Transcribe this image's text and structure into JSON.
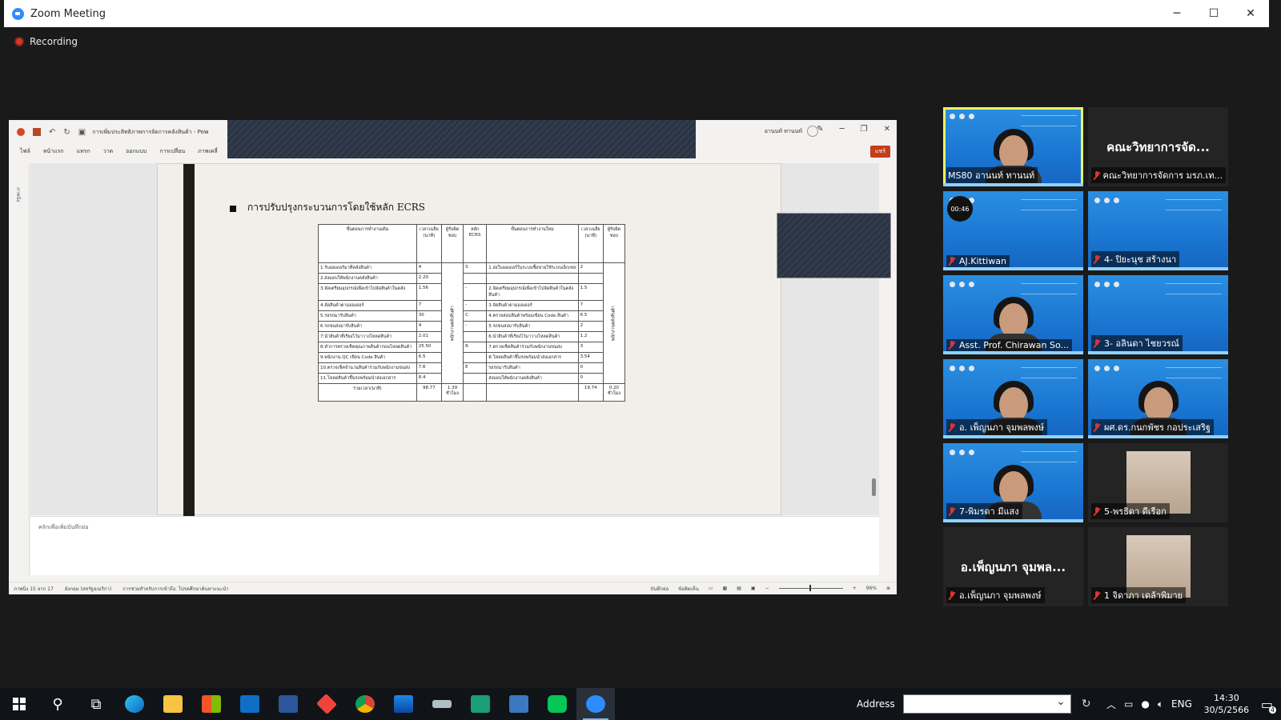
{
  "window": {
    "title": "Zoom Meeting"
  },
  "recording": {
    "label": "Recording"
  },
  "ppt": {
    "doc_name": "การเพิ่มประสิทธิภาพการจัดการคลังสินค้า - Pow",
    "user_name": "อานนท์ ทานนท์",
    "share_label": "แชร์",
    "ribbon_tabs": [
      "ไฟล์",
      "หน้าแรก",
      "แทรก",
      "วาด",
      "ออกแบบ",
      "การเปลี่ยน",
      "ภาพเคลื่"
    ],
    "thumb_pane_label": "ภาพนิ่ง",
    "notes_placeholder": "คลิกเพื่อเพิ่มบันทึกย่อ",
    "status_left": [
      "ภาพนิ่ง 15 จาก 17",
      "อังกฤษ (สหรัฐอเมริกา)",
      "การช่วยสำหรับการเข้าถึง: โปรดศึกษาค้นหาแนะนำ"
    ],
    "status_right": [
      "บันทึกย่อ",
      "ข้อคิดเห็น",
      "96%"
    ],
    "slide": {
      "title": "การปรับปรุงกระบวนการโดยใช้หลัก ECRS",
      "headers": [
        "ขั้นตอนการทำงานเดิม",
        "เวลาเฉลี่ย (นาที)",
        "ผู้รับผิดชอบ",
        "หลัก ECRS",
        "ขั้นตอนการทำงานใหม่",
        "เวลาเฉลี่ย (นาที)",
        "ผู้รับผิดชอบ"
      ],
      "rows": [
        [
          "1.รับออเดอร์มาที่คลังสินค้า",
          "4",
          "S",
          "1.ส่งใบออเดอร์ในระบบซื้อขายใช้ระบบเอ็กเซล",
          "2"
        ],
        [
          "2.ส่งมอบให้พนักงานคลังสินค้า",
          "2.20",
          "",
          "",
          ""
        ],
        [
          "3.จัดเตรียมอุปกรณ์เพื่อเข้าไปจัดสินค้าในคลัง",
          "1.56",
          "-",
          "2.จัดเตรียมอุปกรณ์เพื่อเข้าไปจัดสินค้าในคลังสินค้า",
          "1.5"
        ],
        [
          "4.จัดสินค้าตามออเดอร์",
          "7",
          "-",
          "3.จัดสินค้าตามออเดอร์",
          "7"
        ],
        [
          "5.รอรถมารับสินค้า",
          "30",
          "C",
          "4.ตรวจสอบสินค้าพร้อมเขียน Code สินค้า",
          "6.5"
        ],
        [
          "6.รถขนส่งมารับสินค้า",
          "4",
          "-",
          "5.รถขนส่งมารับสินค้า",
          "2"
        ],
        [
          "7.นำสินค้าที่เรียงไว้มาวางโหลดสินค้า",
          "2.01",
          "",
          "6.นำสินค้าที่เรียงไว้มาวางโหลดสินค้า",
          "1.2"
        ],
        [
          "8.ทำการตรวจเช็คคุณภาพสินค้าก่อนโหลดสินค้า",
          "25.50",
          "R",
          "7.ตรวจเช็คสินค้าร่วมกับพนักงานขนส่ง",
          "3"
        ],
        [
          "9.พนักงาน QC เขียน Code สินค้า",
          "6.5",
          "",
          "8.โหลดสินค้าขึ้นรถพร้อมนำส่งเอกสาร",
          "3.54"
        ],
        [
          "10.ตรวจเช็คจำนวนสินค้าร่วมกับพนักงานขนส่ง",
          "7.6",
          "E",
          "รอรถมารับสินค้า",
          "0"
        ],
        [
          "11.โหลดสินค้าขึ้นรถพร้อมนำส่งเอกสาร",
          "8.4",
          "",
          "ส่งมอบให้พนักงานคลังสินค้า",
          "0"
        ]
      ],
      "staff_label": "พนักงานคลังสินค้า",
      "total_label": "รวมเวลา(นาที)",
      "total_old": "98.77",
      "total_old_hours": "1.39 ชั่วโมง",
      "total_new": "19.74",
      "total_new_hours": "0.20 ชั่วโมง"
    }
  },
  "participants": [
    {
      "name": "MS80 อานนท์ ทานนท์",
      "type": "video",
      "active": true,
      "mic_off": false
    },
    {
      "name": "คณะวิทยาการจัดการ มรภ.เท...",
      "big_name": "คณะวิทยาการจัด...",
      "type": "name",
      "mic_off": true
    },
    {
      "name": "AJ.Kittiwan",
      "type": "video-empty",
      "timer": "00:46",
      "mic_off": true
    },
    {
      "name": "4- ปิยะนุช สร้างนา",
      "type": "video-empty",
      "mic_off": true
    },
    {
      "name": "Asst. Prof. Chirawan So...",
      "type": "video",
      "mic_off": true
    },
    {
      "name": "3- อลินดา ไชยวรณ์",
      "type": "video-empty",
      "mic_off": true
    },
    {
      "name": "อ. เพ็ญนภา จุมพลพงษ์",
      "type": "video",
      "mic_off": true
    },
    {
      "name": "ผศ.ดร.กนกพัชร กอประเสริฐ",
      "type": "video",
      "mic_off": true
    },
    {
      "name": "7-พิมรดา มีแสง",
      "type": "video",
      "mic_off": true
    },
    {
      "name": "5-พรธิดา ดีเรือก",
      "type": "avatar",
      "mic_off": true
    },
    {
      "name": "อ.เพ็ญนภา จุมพลพงษ์",
      "big_name": "อ.เพ็ญนภา จุมพล...",
      "type": "name",
      "mic_off": true
    },
    {
      "name": "1 จิดาภา เดล้าพิมาย",
      "type": "avatar",
      "mic_off": true
    }
  ],
  "taskbar": {
    "address_label": "Address",
    "language": "ENG",
    "time": "14:30",
    "date": "30/5/2566",
    "notifications": "4",
    "apps": [
      "edge",
      "file-explorer",
      "store",
      "mail",
      "word",
      "anydesk",
      "chrome",
      "photos",
      "scanner",
      "app-green",
      "office",
      "line",
      "zoom"
    ]
  }
}
